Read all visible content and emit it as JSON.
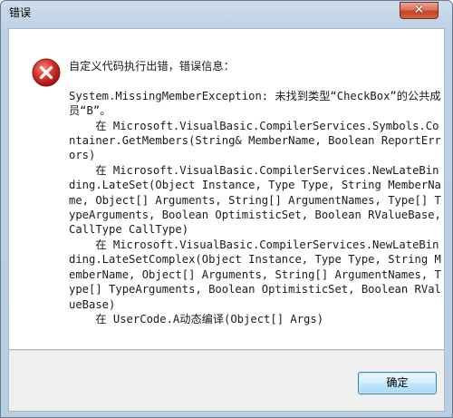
{
  "window": {
    "title": "错误",
    "close_glyph": "✕"
  },
  "message": {
    "icon": "error-x-icon",
    "text": "自定义代码执行出错，错误信息：\n\nSystem.MissingMemberException: 未找到类型“CheckBox”的公共成员“B”。\n    在 Microsoft.VisualBasic.CompilerServices.Symbols.Container.GetMembers(String& MemberName, Boolean ReportErrors)\n    在 Microsoft.VisualBasic.CompilerServices.NewLateBinding.LateSet(Object Instance, Type Type, String MemberName, Object[] Arguments, String[] ArgumentNames, Type[] TypeArguments, Boolean OptimisticSet, Boolean RValueBase, CallType CallType)\n    在 Microsoft.VisualBasic.CompilerServices.NewLateBinding.LateSetComplex(Object Instance, Type Type, String MemberName, Object[] Arguments, String[] ArgumentNames, Type[] TypeArguments, Boolean OptimisticSet, Boolean RValueBase)\n    在 UserCode.A动态编译(Object[] Args)"
  },
  "buttons": {
    "ok_label": "确定"
  },
  "colors": {
    "error_red": "#d8312b",
    "frame_blue": "#bfd1e5",
    "button_border": "#3c7fb1"
  }
}
